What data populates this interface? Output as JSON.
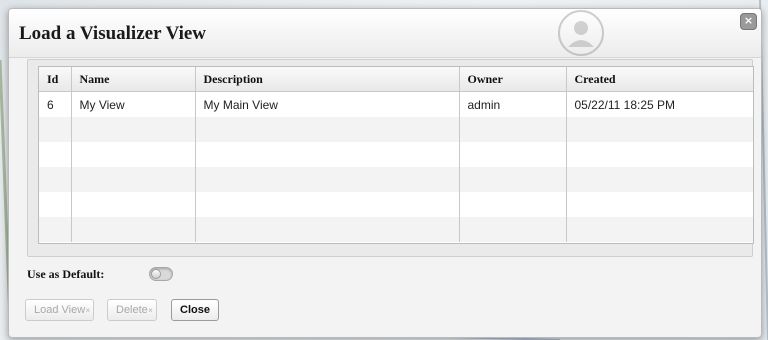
{
  "dialog": {
    "title": "Load a Visualizer View",
    "close_glyph": "×"
  },
  "table": {
    "headers": [
      "Id",
      "Name",
      "Description",
      "Owner",
      "Created"
    ],
    "rows": [
      [
        "6",
        "My View",
        "My Main View",
        "admin",
        "05/22/11 18:25 PM"
      ]
    ]
  },
  "default_setting": {
    "label": "Use as Default:",
    "enabled": false
  },
  "buttons": {
    "load": "Load View",
    "delete": "Delete",
    "close": "Close",
    "disabled_mark": "×"
  },
  "colors": {
    "dialog_bg": "#f3f3f3",
    "table_border": "#c8c8c8",
    "alt_row": "#f3f3f3"
  },
  "icons": {
    "title_watermark": "user-avatar-icon",
    "close": "close-icon",
    "toggle": "toggle-switch-icon"
  }
}
